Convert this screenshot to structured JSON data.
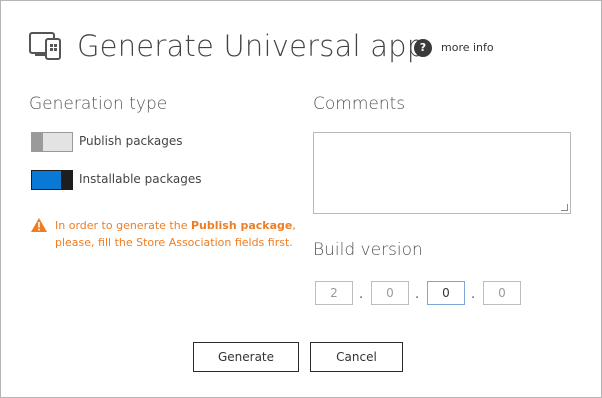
{
  "dialog": {
    "title": "Generate Universal app",
    "help_label": "more info",
    "help_icon": "question-icon"
  },
  "generation": {
    "title": "Generation type",
    "options": [
      {
        "label": "Publish packages",
        "state": "off"
      },
      {
        "label": "Installable packages",
        "state": "on"
      }
    ],
    "warning": {
      "prefix": "In order to generate the ",
      "highlight": "Publish package",
      "suffix_line1": ",",
      "line2": "please, fill the Store Association fields first.",
      "color": "#ef7d22"
    }
  },
  "comments": {
    "title": "Comments",
    "value": ""
  },
  "build": {
    "title": "Build version",
    "fields": [
      "2",
      "0",
      "0",
      "0"
    ],
    "separator": "."
  },
  "buttons": {
    "generate": "Generate",
    "cancel": "Cancel"
  },
  "colors": {
    "toggle_on": "#0a79d6",
    "accent_warning": "#ef7d22"
  }
}
